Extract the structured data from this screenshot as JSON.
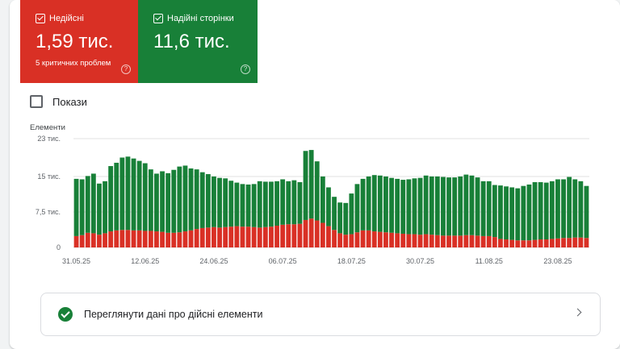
{
  "cards": {
    "invalid": {
      "label": "Недійсні",
      "value": "1,59 тис.",
      "sub": "5 критичних проблем",
      "color": "#d93025",
      "icon": "checkbox-checked-icon"
    },
    "valid": {
      "label": "Надійні сторінки",
      "value": "11,6 тис.",
      "color": "#188038",
      "icon": "checkbox-checked-icon"
    }
  },
  "shows_toggle": {
    "label": "Покази",
    "checked": false
  },
  "action_row": {
    "label": "Переглянути дані про дійсні елементи",
    "icon": "check-circle-icon",
    "chevron": "chevron-right-icon"
  },
  "chart_data": {
    "type": "bar",
    "stacked": true,
    "ylabel": "Елементи",
    "ylim": [
      0,
      23000
    ],
    "yticks": [
      0,
      7500,
      15000,
      23000
    ],
    "ytick_labels": [
      "0",
      "7,5 тис.",
      "15 тис.",
      "23 тис."
    ],
    "xtick_labels": [
      {
        "index": 0,
        "label": "31.05.25"
      },
      {
        "index": 12,
        "label": "12.06.25"
      },
      {
        "index": 24,
        "label": "24.06.25"
      },
      {
        "index": 36,
        "label": "06.07.25"
      },
      {
        "index": 48,
        "label": "18.07.25"
      },
      {
        "index": 60,
        "label": "30.07.25"
      },
      {
        "index": 72,
        "label": "11.08.25"
      },
      {
        "index": 84,
        "label": "23.08.25"
      }
    ],
    "grid": true,
    "series": [
      {
        "name": "Недійсні",
        "color": "#d93025",
        "values": [
          2400,
          2600,
          3100,
          3000,
          2700,
          3000,
          3400,
          3600,
          3700,
          3700,
          3600,
          3600,
          3500,
          3500,
          3400,
          3300,
          3100,
          3100,
          3200,
          3400,
          3600,
          3900,
          4100,
          4200,
          4300,
          4200,
          4300,
          4400,
          4500,
          4400,
          4400,
          4300,
          4200,
          4300,
          4400,
          4600,
          4800,
          4900,
          4900,
          5000,
          5800,
          6100,
          5700,
          5200,
          4500,
          3700,
          3000,
          2700,
          2800,
          3200,
          3600,
          3600,
          3400,
          3300,
          3200,
          3100,
          3000,
          2900,
          2800,
          2800,
          2700,
          2800,
          2700,
          2600,
          2500,
          2500,
          2500,
          2500,
          2600,
          2600,
          2500,
          2400,
          2400,
          2200,
          1800,
          1700,
          1600,
          1500,
          1500,
          1500,
          1600,
          1700,
          1700,
          1800,
          1900,
          2000,
          2000,
          2100,
          2100,
          2000
        ]
      },
      {
        "name": "Надійні сторінки",
        "color": "#188038",
        "values": [
          12100,
          11800,
          12000,
          12600,
          10800,
          11000,
          13800,
          14300,
          15300,
          15500,
          15200,
          14700,
          14300,
          13000,
          12200,
          12800,
          12600,
          13300,
          13900,
          13900,
          13100,
          12600,
          11800,
          11300,
          10700,
          10500,
          10300,
          9700,
          9200,
          9000,
          8900,
          9100,
          9800,
          9600,
          9500,
          9400,
          9600,
          9100,
          9300,
          8800,
          14600,
          14500,
          12500,
          9800,
          8200,
          7000,
          6500,
          6700,
          8600,
          10200,
          10900,
          11400,
          11900,
          11900,
          11800,
          11600,
          11500,
          11400,
          11600,
          11800,
          12000,
          12400,
          12300,
          12400,
          12400,
          12300,
          12300,
          12500,
          12800,
          12600,
          12300,
          11600,
          11600,
          11000,
          11300,
          11200,
          11100,
          11000,
          11500,
          11800,
          12200,
          12100,
          12000,
          12200,
          12500,
          12400,
          12900,
          12300,
          11900,
          11000
        ]
      }
    ]
  }
}
